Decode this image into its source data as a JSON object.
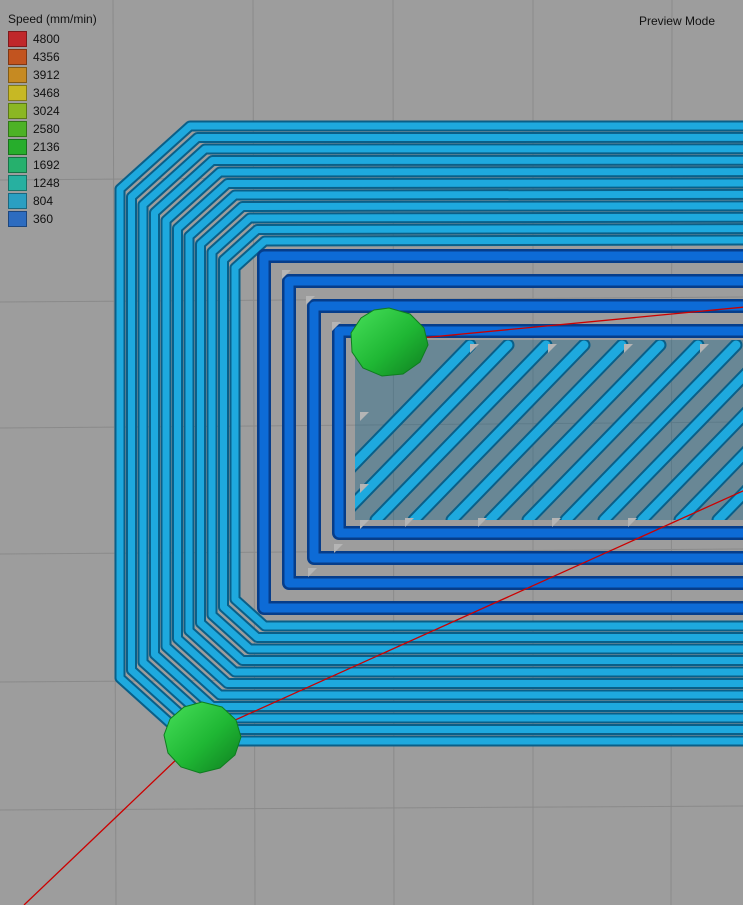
{
  "legend": {
    "title": "Speed (mm/min)",
    "entries": [
      {
        "label": "4800",
        "color": "#c0272a"
      },
      {
        "label": "4356",
        "color": "#c2541f"
      },
      {
        "label": "3912",
        "color": "#c68a22"
      },
      {
        "label": "3468",
        "color": "#c7b824"
      },
      {
        "label": "3024",
        "color": "#8bb723"
      },
      {
        "label": "2580",
        "color": "#4db226"
      },
      {
        "label": "2136",
        "color": "#27ad2c"
      },
      {
        "label": "1692",
        "color": "#26b06d"
      },
      {
        "label": "1248",
        "color": "#27b0a0"
      },
      {
        "label": "804",
        "color": "#2a9fc2"
      },
      {
        "label": "360",
        "color": "#2d6cc0"
      }
    ]
  },
  "mode_label": "Preview Mode",
  "colors": {
    "background": "#9d9d9d",
    "grid": "#8a8a8a",
    "outer_perimeter": "#1ea9de",
    "inner_perimeter": "#0d6bd6",
    "infill": "#1ea9de",
    "travel_line": "#cc0000",
    "seam_marker": "#1fb734"
  }
}
